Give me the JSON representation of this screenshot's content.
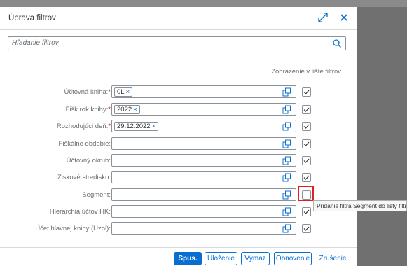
{
  "dialog": {
    "title": "Úprava filtrov",
    "search_placeholder": "Hľadanie filtrov",
    "column_header": "Zobrazenie v lište filtrov"
  },
  "filters": [
    {
      "label": "Účtovná kniha:",
      "required": true,
      "token": "0L",
      "shown": true
    },
    {
      "label": "Fišk.rok knihy:",
      "required": true,
      "token": "2022",
      "shown": true
    },
    {
      "label": "Rozhodujúci deň:",
      "required": true,
      "token": "29.12.2022",
      "shown": true
    },
    {
      "label": "Fiškálne obdobie:",
      "required": false,
      "token": null,
      "shown": true
    },
    {
      "label": "Účtovný okruh:",
      "required": false,
      "token": null,
      "shown": true
    },
    {
      "label": "Ziskové stredisko:",
      "required": false,
      "token": null,
      "shown": true
    },
    {
      "label": "Segment:",
      "required": false,
      "token": null,
      "shown": false
    },
    {
      "label": "Hierarchia účtov HK:",
      "required": false,
      "token": null,
      "shown": true
    },
    {
      "label": "Účet hlavnej knihy (Uzol):",
      "required": false,
      "token": null,
      "shown": true
    }
  ],
  "required_marker": "*",
  "token_remove": "×",
  "tooltip": "Pridanie filtra Segment do lišty filtrov",
  "footer": {
    "go": "Spus.",
    "save": "Uloženie",
    "delete": "Výmaz",
    "restore": "Obnovenie",
    "cancel": "Zrušenie"
  },
  "colors": {
    "accent": "#0a6ed1",
    "required": "#bb0000",
    "focus_highlight": "#e02020"
  },
  "icons": {
    "expand": "expand-icon",
    "close": "close-icon",
    "search": "search-icon",
    "value_help": "value-help-icon",
    "checkbox": "checkmark-icon"
  }
}
